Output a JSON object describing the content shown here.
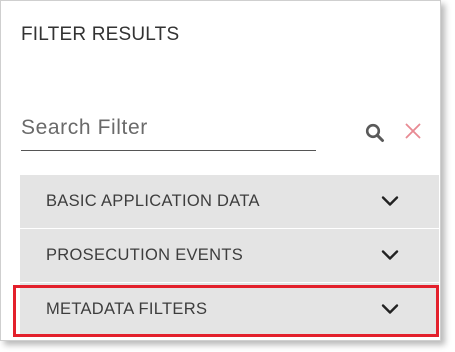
{
  "panel": {
    "title": "FILTER RESULTS"
  },
  "search": {
    "placeholder": "Search Filter",
    "value": "",
    "search_icon": "search-icon",
    "clear_icon": "close-icon"
  },
  "accordion": {
    "items": [
      {
        "label": "BASIC APPLICATION DATA",
        "icon": "chevron-down-icon",
        "expanded": false
      },
      {
        "label": "PROSECUTION EVENTS",
        "icon": "chevron-down-icon",
        "expanded": false
      },
      {
        "label": "METADATA FILTERS",
        "icon": "chevron-down-icon",
        "expanded": false,
        "highlighted": true
      }
    ]
  },
  "colors": {
    "panel_bg": "#ffffff",
    "item_bg": "#e4e4e4",
    "text": "#3d3d3d",
    "clear_icon": "#e88a93",
    "highlight_border": "#e3202c"
  }
}
